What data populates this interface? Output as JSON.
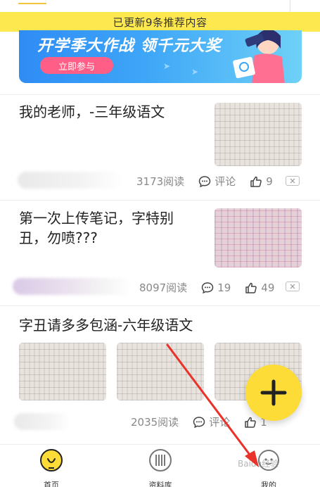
{
  "banner": {
    "text": "已更新9条推荐内容"
  },
  "promo": {
    "title": "开学季大作战 领千元大奖",
    "button_label": "立即参与"
  },
  "posts": [
    {
      "title": "我的老师，-三年级语文",
      "reads": "3173阅读",
      "comments": "评论",
      "likes": "9"
    },
    {
      "title_line1": "第一次上传笔记，字特别",
      "title_line2": "丑，勿喷???",
      "reads": "8097阅读",
      "comments": "19",
      "likes": "49"
    },
    {
      "title": "字丑请多多包涵-六年级语文",
      "reads": "2035阅读",
      "comments": "评论",
      "likes": "1"
    }
  ],
  "tabs": [
    {
      "label": "首页"
    },
    {
      "label": "资料库"
    },
    {
      "label": "我的"
    }
  ],
  "watermark": "Baidu经验",
  "colors": {
    "accent_yellow": "#fddc38",
    "banner_yellow": "#fde94f",
    "arrow_red": "#e8322a"
  },
  "icons": [
    "comment-icon",
    "thumbs-up-icon",
    "close-icon",
    "plus-icon",
    "home-bulb-icon",
    "library-icon",
    "profile-icon"
  ]
}
